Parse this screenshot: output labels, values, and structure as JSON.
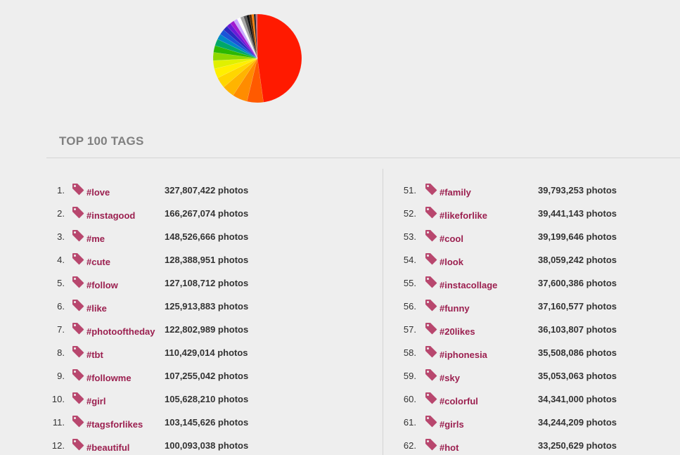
{
  "section_title": "TOP 100 TAGS",
  "unit": "photos",
  "chart_data": {
    "type": "pie",
    "title": "",
    "slices": [
      {
        "value": 48.0,
        "color": "#ff1a00"
      },
      {
        "value": 6.0,
        "color": "#ff5a00"
      },
      {
        "value": 5.5,
        "color": "#ff8c00"
      },
      {
        "value": 4.5,
        "color": "#ffb400"
      },
      {
        "value": 4.0,
        "color": "#ffd600"
      },
      {
        "value": 3.5,
        "color": "#ffef00"
      },
      {
        "value": 3.0,
        "color": "#e0f000"
      },
      {
        "value": 3.0,
        "color": "#8ed700"
      },
      {
        "value": 2.5,
        "color": "#2db800"
      },
      {
        "value": 2.5,
        "color": "#00a868"
      },
      {
        "value": 2.0,
        "color": "#0088c8"
      },
      {
        "value": 2.0,
        "color": "#1a55d8"
      },
      {
        "value": 1.8,
        "color": "#2a2ac0"
      },
      {
        "value": 1.6,
        "color": "#6a1ad8"
      },
      {
        "value": 1.5,
        "color": "#a01ad0"
      },
      {
        "value": 1.4,
        "color": "#c8a8ff"
      },
      {
        "value": 1.3,
        "color": "#ffffff"
      },
      {
        "value": 1.2,
        "color": "#a8a8a8"
      },
      {
        "value": 1.1,
        "color": "#555555"
      },
      {
        "value": 1.0,
        "color": "#111111"
      },
      {
        "value": 0.9,
        "color": "#5a2a00"
      },
      {
        "value": 0.8,
        "color": "#ff7a00"
      },
      {
        "value": 0.7,
        "color": "#222222"
      },
      {
        "value": 0.6,
        "color": "#c07080"
      }
    ]
  },
  "colors": {
    "tag_link": "#9b1f4f",
    "tag_icon": "#b8476e",
    "text": "#333333",
    "section_title": "#808080",
    "background": "#eeeeee"
  },
  "left_column": [
    {
      "rank": "1.",
      "tag": "#love",
      "count": "327,807,422 photos"
    },
    {
      "rank": "2.",
      "tag": "#instagood",
      "count": "166,267,074 photos"
    },
    {
      "rank": "3.",
      "tag": "#me",
      "count": "148,526,666 photos"
    },
    {
      "rank": "4.",
      "tag": "#cute",
      "count": "128,388,951 photos"
    },
    {
      "rank": "5.",
      "tag": "#follow",
      "count": "127,108,712 photos"
    },
    {
      "rank": "6.",
      "tag": "#like",
      "count": "125,913,883 photos"
    },
    {
      "rank": "7.",
      "tag": "#photooftheday",
      "count": "122,802,989 photos"
    },
    {
      "rank": "8.",
      "tag": "#tbt",
      "count": "110,429,014 photos"
    },
    {
      "rank": "9.",
      "tag": "#followme",
      "count": "107,255,042 photos"
    },
    {
      "rank": "10.",
      "tag": "#girl",
      "count": "105,628,210 photos"
    },
    {
      "rank": "11.",
      "tag": "#tagsforlikes",
      "count": "103,145,626 photos"
    },
    {
      "rank": "12.",
      "tag": "#beautiful",
      "count": "100,093,038 photos"
    }
  ],
  "right_column": [
    {
      "rank": "51.",
      "tag": "#family",
      "count": "39,793,253 photos"
    },
    {
      "rank": "52.",
      "tag": "#likeforlike",
      "count": "39,441,143 photos"
    },
    {
      "rank": "53.",
      "tag": "#cool",
      "count": "39,199,646 photos"
    },
    {
      "rank": "54.",
      "tag": "#look",
      "count": "38,059,242 photos"
    },
    {
      "rank": "55.",
      "tag": "#instacollage",
      "count": "37,600,386 photos"
    },
    {
      "rank": "56.",
      "tag": "#funny",
      "count": "37,160,577 photos"
    },
    {
      "rank": "57.",
      "tag": "#20likes",
      "count": "36,103,807 photos"
    },
    {
      "rank": "58.",
      "tag": "#iphonesia",
      "count": "35,508,086 photos"
    },
    {
      "rank": "59.",
      "tag": "#sky",
      "count": "35,053,063 photos"
    },
    {
      "rank": "60.",
      "tag": "#colorful",
      "count": "34,341,000 photos"
    },
    {
      "rank": "61.",
      "tag": "#girls",
      "count": "34,244,209 photos"
    },
    {
      "rank": "62.",
      "tag": "#hot",
      "count": "33,250,629 photos"
    }
  ]
}
